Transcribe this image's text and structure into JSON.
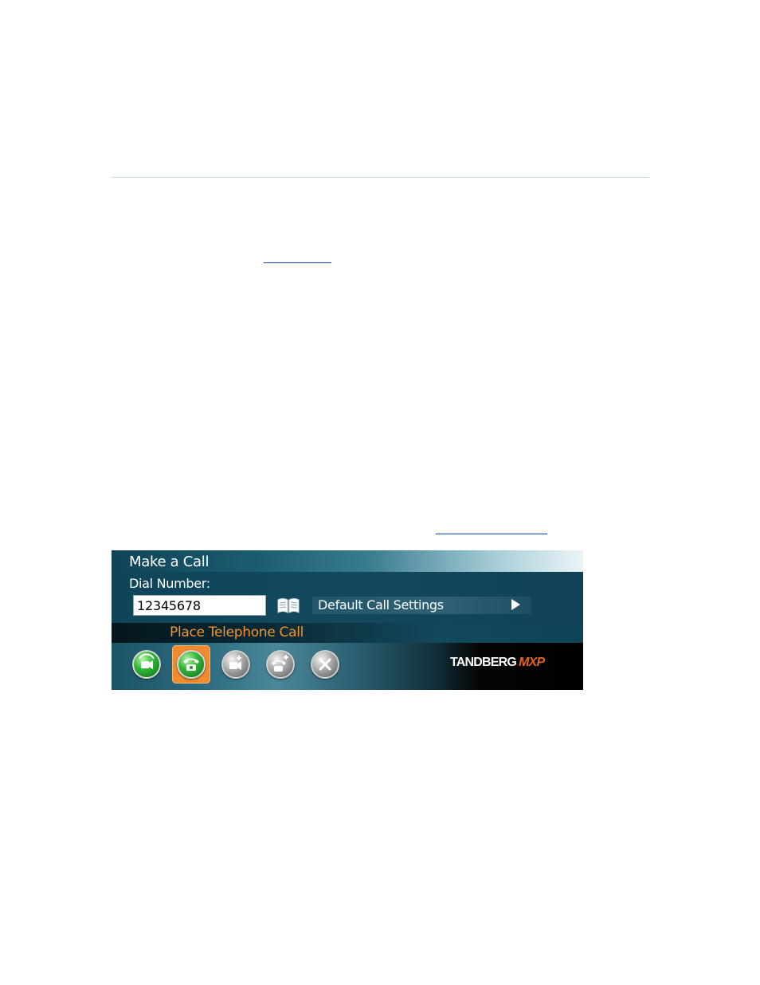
{
  "panel": {
    "title": "Make a Call",
    "dial_label": "Dial Number:",
    "dial_value": "12345678",
    "settings_label": "Default Call Settings",
    "action_label": "Place Telephone Call",
    "brand_main": "TANDBERG",
    "brand_sub": "MXP"
  },
  "buttons": [
    {
      "name": "video-call",
      "icon": "video-call-icon",
      "selected": false
    },
    {
      "name": "telephone-call",
      "icon": "telephone-icon",
      "selected": true
    },
    {
      "name": "add-video",
      "icon": "add-video-icon",
      "selected": false
    },
    {
      "name": "add-telephone",
      "icon": "add-telephone-icon",
      "selected": false
    },
    {
      "name": "cancel",
      "icon": "close-icon",
      "selected": false
    }
  ],
  "colors": {
    "panel_bg": "#0f4255",
    "accent_orange": "#ef8a2f",
    "label_orange": "#f0952f",
    "brand_orange": "#e0661e"
  }
}
